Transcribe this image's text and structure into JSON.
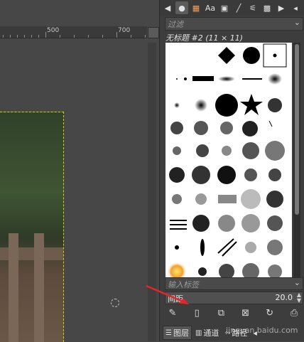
{
  "ruler": {
    "labels": [
      "500",
      "700"
    ]
  },
  "panel": {
    "tabs": [
      "brush-tab",
      "pattern-tab",
      "font-tab",
      "document-tab",
      "paint-dynamics-tab",
      "tool-presets-tab"
    ],
    "filter_placeholder": "过滤",
    "brush_title": "无标题 #2 (11 × 11)",
    "tag_placeholder": "输入标签",
    "spacing_label": "间距",
    "spacing_value": "20.0"
  },
  "bottom_tabs": [
    {
      "label": "图层"
    },
    {
      "label": "通道"
    },
    {
      "label": "路径"
    }
  ],
  "watermark": "jingyan.baidu.com",
  "colors": {
    "accent_arrow": "#e0282a",
    "selection_border": "#d4d400"
  }
}
